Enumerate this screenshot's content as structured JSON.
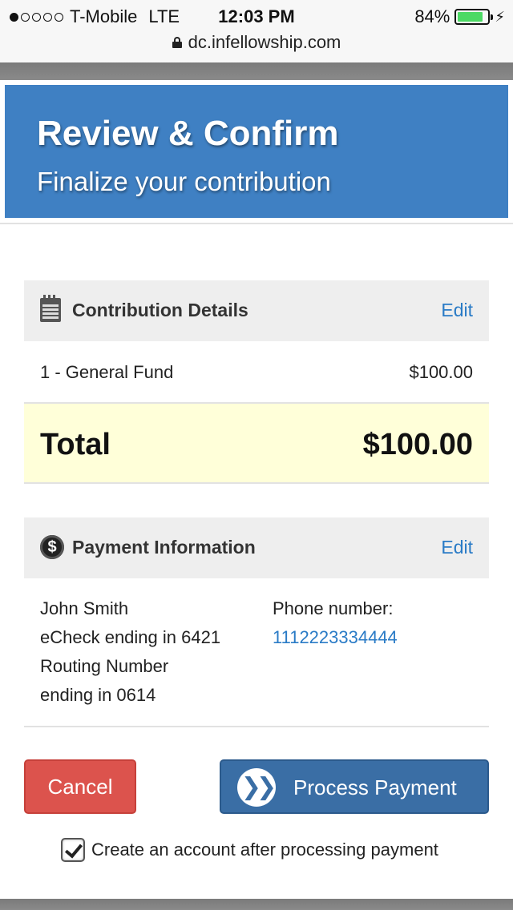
{
  "status_bar": {
    "carrier": "T-Mobile",
    "network": "LTE",
    "time": "12:03 PM",
    "battery_pct": "84%",
    "battery_level": 0.84,
    "signal_bars_filled": 1,
    "signal_bars_total": 5
  },
  "browser": {
    "url": "dc.infellowship.com"
  },
  "header": {
    "title": "Review & Confirm",
    "subtitle": "Finalize your contribution",
    "color": "#3f80c3"
  },
  "contribution": {
    "heading": "Contribution Details",
    "edit_label": "Edit",
    "items": [
      {
        "name": "1 - General Fund",
        "amount": "$100.00"
      }
    ],
    "total_label": "Total",
    "total_amount": "$100.00"
  },
  "payment": {
    "heading": "Payment Information",
    "edit_label": "Edit",
    "name": "John Smith",
    "method": "eCheck ending in 6421",
    "routing_line1": "Routing Number",
    "routing_line2": "ending in 0614",
    "phone_label": "Phone number:",
    "phone_value": "1112223334444"
  },
  "actions": {
    "cancel_label": "Cancel",
    "process_label": "Process Payment",
    "create_account_label": "Create an account after processing payment",
    "create_account_checked": true
  },
  "colors": {
    "link": "#2a7bc6",
    "cancel": "#dc534d",
    "process": "#3a6ea5",
    "total_bg": "#ffffd9"
  }
}
